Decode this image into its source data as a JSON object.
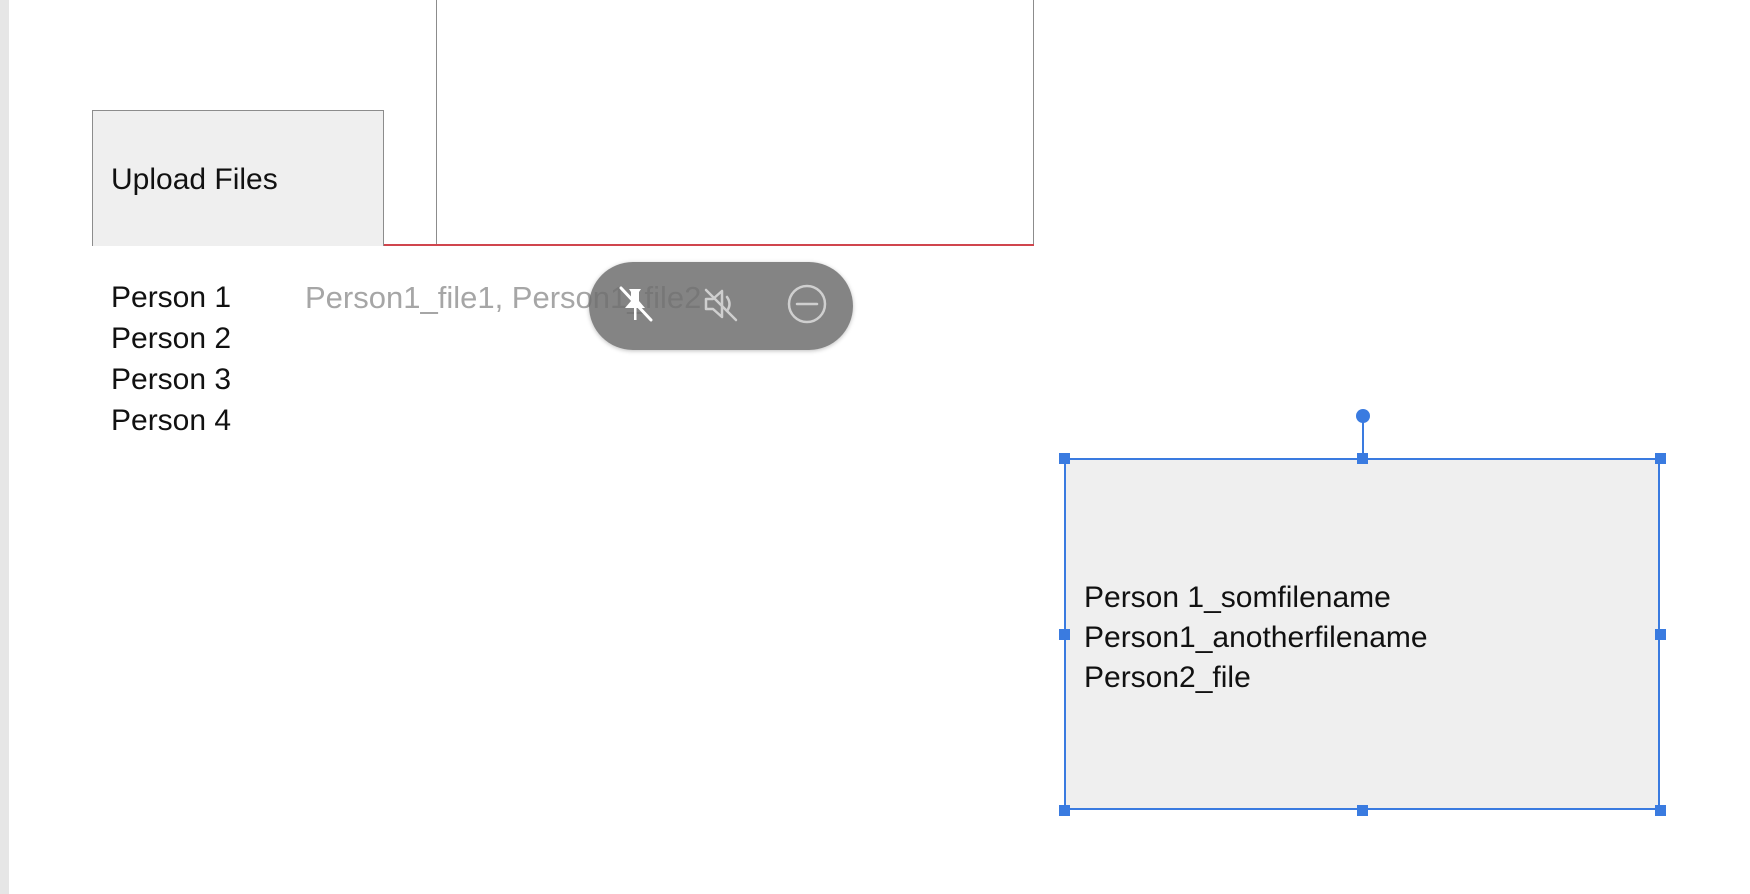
{
  "upload": {
    "label": "Upload Files"
  },
  "people": [
    "Person 1",
    "Person 2",
    "Person 3",
    "Person 4"
  ],
  "file_preview": "Person1_file1, Person1_file2",
  "overlay": {
    "icons": [
      "unpin-icon",
      "mute-icon",
      "minimize-icon"
    ]
  },
  "selected_box": {
    "lines": [
      "Person 1_somfilename",
      "Person1_anotherfilename",
      "Person2_file"
    ]
  },
  "colors": {
    "selection_accent": "#3a7be0",
    "divider_red": "#d0454d",
    "box_fill": "#efefef"
  }
}
